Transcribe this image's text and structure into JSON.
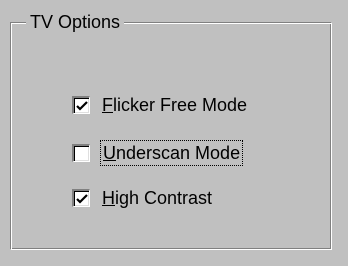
{
  "group": {
    "title": "TV Options"
  },
  "options": [
    {
      "mnemonic": "F",
      "rest": "licker Free Mode",
      "checked": true
    },
    {
      "mnemonic": "U",
      "rest": "nderscan Mode",
      "checked": false,
      "focused": true
    },
    {
      "mnemonic": "H",
      "rest": "igh Contrast",
      "checked": true
    }
  ],
  "colors": {
    "face": "#c0c0c0",
    "shadow": "#808080",
    "highlight": "#ffffff"
  }
}
